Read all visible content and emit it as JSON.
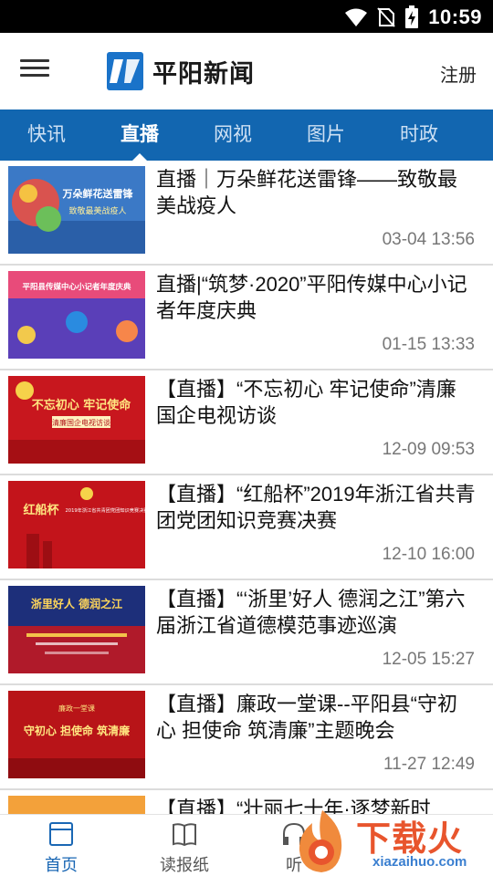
{
  "status_bar": {
    "time": "10:59"
  },
  "app": {
    "title": "平阳新闻",
    "register_label": "注册"
  },
  "tabs": [
    {
      "label": "快讯",
      "active": false
    },
    {
      "label": "直播",
      "active": true
    },
    {
      "label": "网视",
      "active": false
    },
    {
      "label": "图片",
      "active": false
    },
    {
      "label": "时政",
      "active": false
    }
  ],
  "news": [
    {
      "title": "直播｜万朵鲜花送雷锋——致敬最美战疫人",
      "date": "03-04 13:56"
    },
    {
      "title": "直播|“筑梦·2020”平阳传媒中心小记者年度庆典",
      "date": "01-15 13:33"
    },
    {
      "title": "【直播】“不忘初心 牢记使命”清廉国企电视访谈",
      "date": "12-09 09:53"
    },
    {
      "title": "【直播】“红船杯”2019年浙江省共青团党团知识竞赛决赛",
      "date": "12-10 16:00"
    },
    {
      "title": "【直播】“‘浙里’好人 德润之江”第六届浙江省道德模范事迹巡演",
      "date": "12-05 15:27"
    },
    {
      "title": "【直播】廉政一堂课--平阳县“守初心 担使命 筑清廉”主题晚会",
      "date": "11-27 12:49"
    },
    {
      "title": "【直播】“壮丽七十年·逐梦新时",
      "date": ""
    }
  ],
  "thumb_text": {
    "t1": "万朵鲜花送雷锋",
    "t1_sub": "致敬最美战疫人",
    "t2": "平阳县传媒中心小记者年度庆典",
    "t3": "不忘初心 牢记使命",
    "t3_sub": "清廉国企电视访谈",
    "t4": "红船杯",
    "t4_sub": "2019年浙江省共青团党团知识竞赛决赛",
    "t5": "浙里好人 德润之江",
    "t6": "守初心 担使命 筑清廉",
    "t6_sub": "廉政一堂课"
  },
  "bottom_nav": [
    {
      "label": "首页",
      "icon": "home-icon",
      "active": true
    },
    {
      "label": "读报纸",
      "icon": "book-icon",
      "active": false
    },
    {
      "label": "听",
      "icon": "headphones-icon",
      "active": false
    }
  ],
  "watermark": {
    "text": "下载火",
    "sub": "xiazaihuo.com"
  },
  "colors": {
    "tab_bar": "#1266b0",
    "nav_active": "#1a67b4",
    "watermark": "#e8552d"
  }
}
